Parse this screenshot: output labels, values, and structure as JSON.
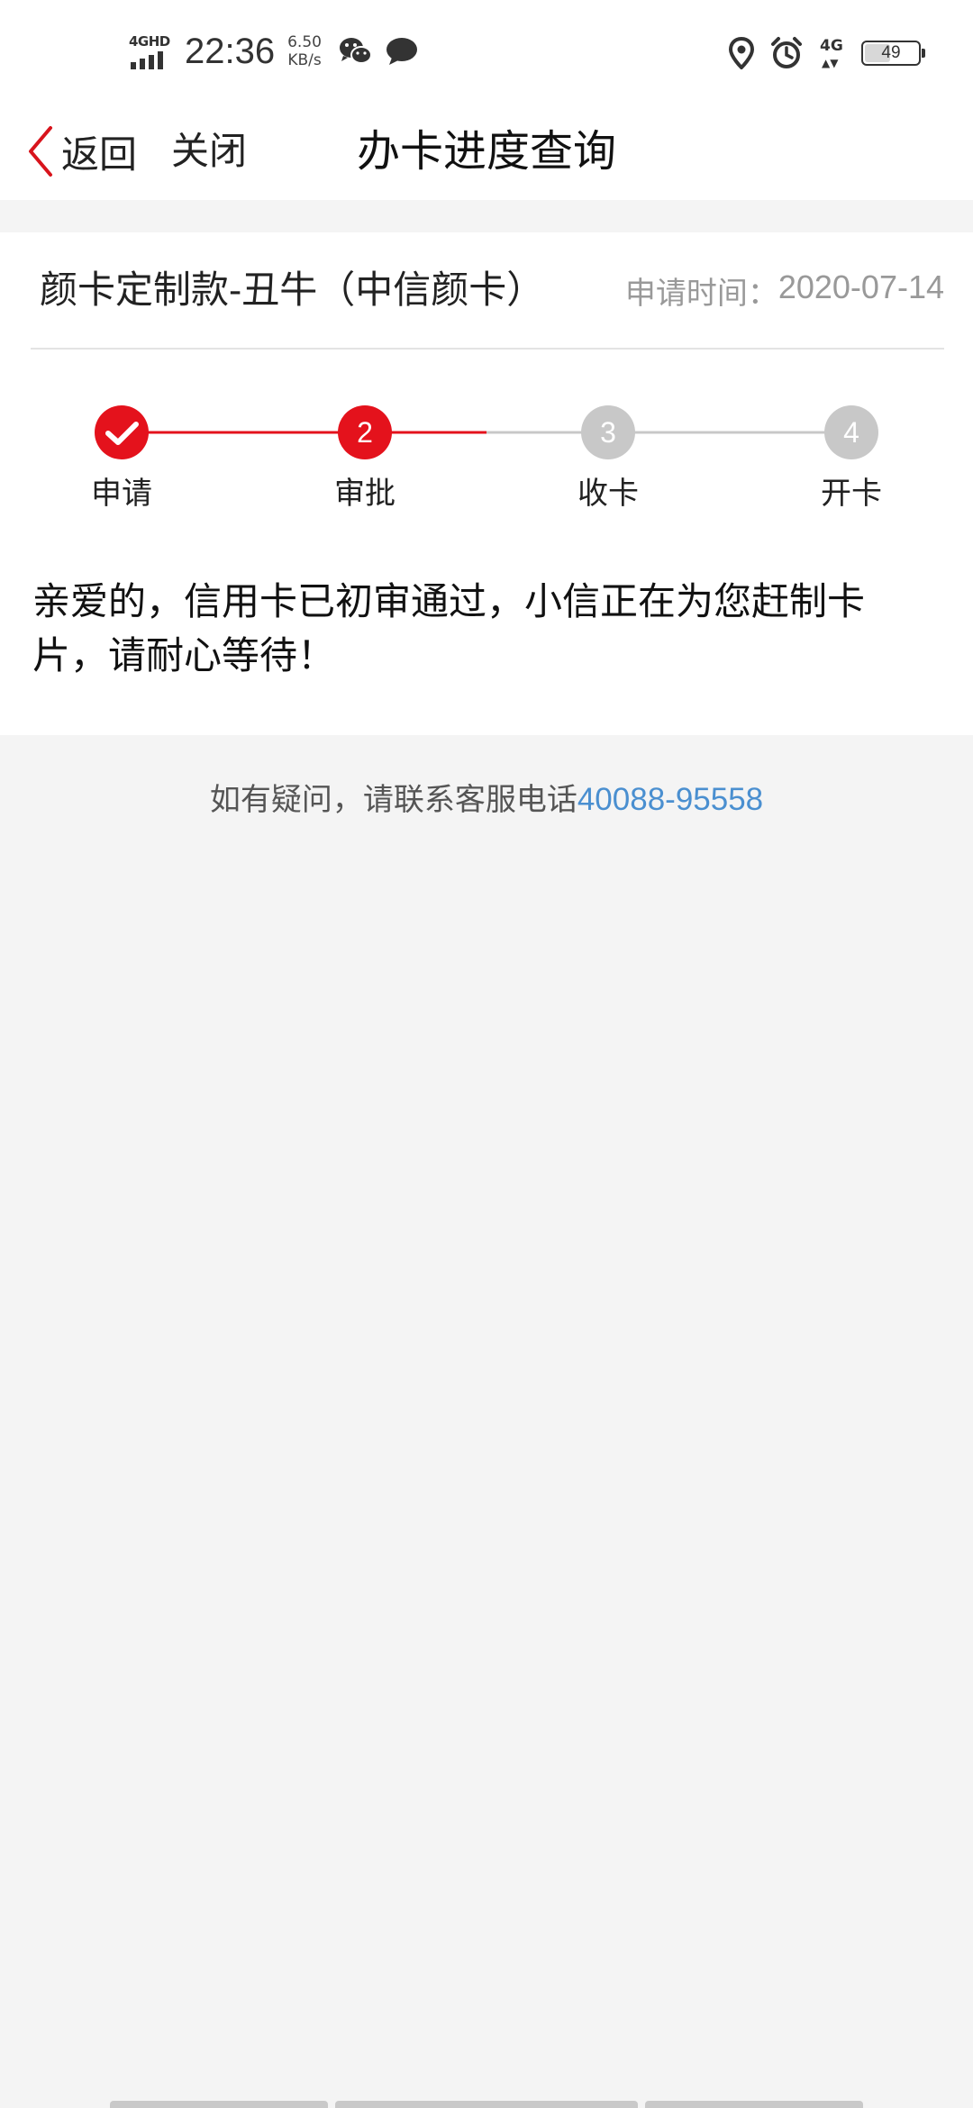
{
  "status_bar": {
    "network_left": "4GHD",
    "time": "22:36",
    "speed_value": "6.50",
    "speed_unit": "KB/s",
    "network_right": "4G",
    "battery": "49",
    "battery_level": 0.49,
    "icons": [
      "wechat-icon",
      "message-icon",
      "location-icon",
      "alarm-icon"
    ]
  },
  "nav": {
    "back_label": "返回",
    "close_label": "关闭",
    "title": "办卡进度查询"
  },
  "card": {
    "name": "颜卡定制款-丑牛（中信颜卡）",
    "apply_time_label": "申请时间：",
    "apply_time": "2020-07-14"
  },
  "progress": {
    "current_step": 2,
    "steps": [
      {
        "number": "1",
        "label": "申请",
        "status": "done"
      },
      {
        "number": "2",
        "label": "审批",
        "status": "current"
      },
      {
        "number": "3",
        "label": "收卡",
        "status": "pending"
      },
      {
        "number": "4",
        "label": "开卡",
        "status": "pending"
      }
    ]
  },
  "message": "亲爱的，信用卡已初审通过，小信正在为您赶制卡片，请耐心等待！",
  "contact": {
    "text": "如有疑问，请联系客服电话",
    "phone": "40088-95558"
  },
  "colors": {
    "accent": "#e4121c",
    "pending": "#c8c8c8",
    "link": "#4a8fd0"
  }
}
